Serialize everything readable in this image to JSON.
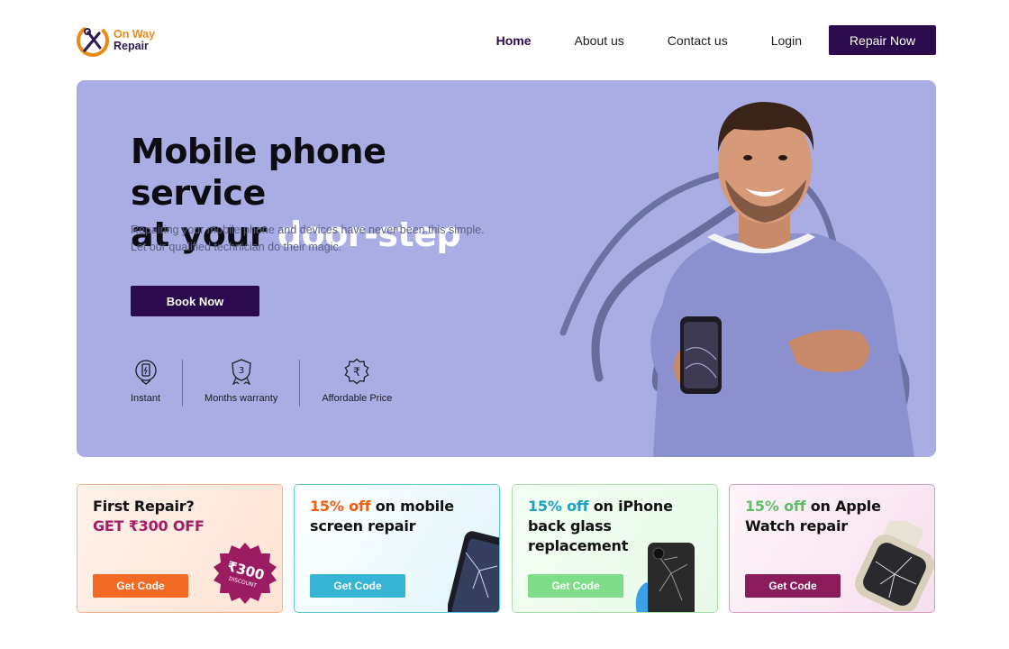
{
  "brand": {
    "line1": "On Way",
    "line2": "Repair"
  },
  "nav": {
    "items": [
      {
        "label": "Home",
        "active": true
      },
      {
        "label": "About us",
        "active": false
      },
      {
        "label": "Contact us",
        "active": false
      },
      {
        "label": "Login",
        "active": false
      }
    ],
    "cta_label": "Repair Now"
  },
  "hero": {
    "title_line1": "Mobile phone service",
    "title_line2_prefix": "at your ",
    "title_line2_highlight": "door-step",
    "subtitle_line1": "Repairing your mobile phone and devices have never been this simple.",
    "subtitle_line2": "Let our qualified technician do their magic.",
    "book_label": "Book Now",
    "features": [
      {
        "label": "Instant",
        "icon": "instant-phone-icon"
      },
      {
        "label": "Months warranty",
        "icon": "warranty-badge-icon",
        "badge_number": "3"
      },
      {
        "label": "Affordable Price",
        "icon": "rupee-badge-icon",
        "symbol": "₹"
      }
    ],
    "background_color": "#a9ade3"
  },
  "promos": [
    {
      "title_line1": "First Repair?",
      "title_line2": "GET ₹300 OFF",
      "button": "Get Code",
      "sticker_line1": "₹300",
      "sticker_line2": "DISCOUNT",
      "accent": "#f26a24"
    },
    {
      "pct": "15% off",
      "title_rest": " on mobile screen repair",
      "button": "Get Code",
      "accent": "#36b4d6"
    },
    {
      "pct": "15% off",
      "title_rest": " on iPhone back glass replacement",
      "button": "Get Code",
      "accent": "#7fdd8a"
    },
    {
      "pct": "15% off",
      "title_rest": " on Apple Watch repair",
      "button": "Get Code",
      "accent": "#8b1c5c"
    }
  ],
  "colors": {
    "primary": "#2b0a4e",
    "brand_orange": "#ea8a13"
  }
}
